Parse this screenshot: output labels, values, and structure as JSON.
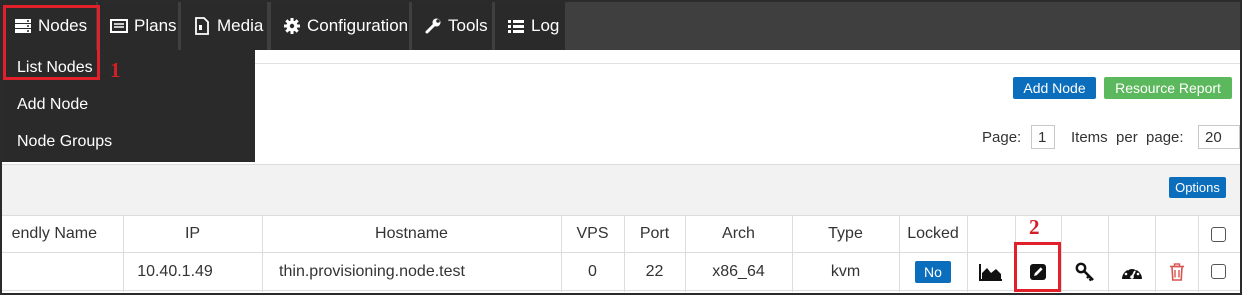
{
  "nav": {
    "tabs": [
      {
        "label": "Nodes",
        "icon": "server-icon"
      },
      {
        "label": "Plans",
        "icon": "list-icon"
      },
      {
        "label": "Media",
        "icon": "file-icon"
      },
      {
        "label": "Configuration",
        "icon": "gear-icon"
      },
      {
        "label": "Tools",
        "icon": "wrench-icon"
      },
      {
        "label": "Log",
        "icon": "log-icon"
      }
    ],
    "dropdown": [
      "List Nodes",
      "Add Node",
      "Node Groups"
    ]
  },
  "annotations": {
    "first": "1",
    "second": "2"
  },
  "toolbar": {
    "add_node": "Add Node",
    "resource_report": "Resource Report",
    "options": "Options",
    "page_label": "Page:",
    "page_value": "1",
    "items_label": "Items  per  page:",
    "items_value": "20"
  },
  "table": {
    "headers": [
      "endly Name",
      "IP",
      "Hostname",
      "VPS",
      "Port",
      "Arch",
      "Type",
      "Locked"
    ],
    "row": {
      "friendly_name": "",
      "ip": "10.40.1.49",
      "hostname": "thin.provisioning.node.test",
      "vps": "0",
      "port": "22",
      "arch": "x86_64",
      "type": "kvm",
      "locked": "No"
    }
  },
  "colors": {
    "primary": "#0a6ebd",
    "success": "#5cb85c",
    "annotation": "#e0202a",
    "delete": "#d9534f"
  }
}
